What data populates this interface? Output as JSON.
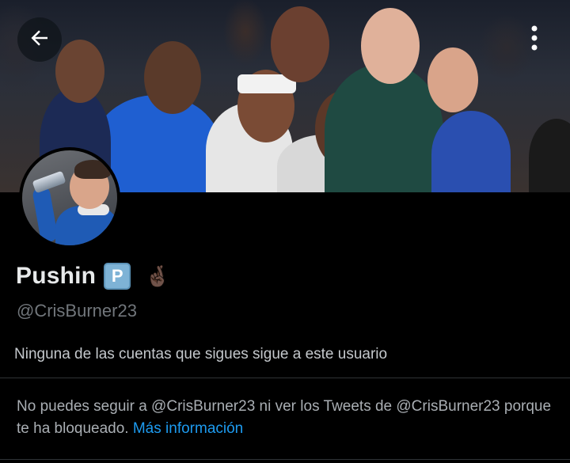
{
  "header": {
    "back_icon": "arrow-left-icon",
    "more_icon": "vertical-ellipsis-icon"
  },
  "profile": {
    "display_name": "Pushin",
    "badge_letter": "P",
    "emoji": "🤞🏿",
    "handle": "@CrisBurner23",
    "followers_note": "Ninguna de las cuentas que sigues sigue a este usuario"
  },
  "blocked": {
    "message": "No puedes seguir a @CrisBurner23 ni ver los Tweets de @CrisBurner23 porque te ha bloqueado. ",
    "link_label": "Más información"
  },
  "colors": {
    "background": "#000000",
    "text_primary": "#e7e9ea",
    "text_secondary": "#71767b",
    "link": "#1d9bf0",
    "divider": "#2f3336"
  }
}
